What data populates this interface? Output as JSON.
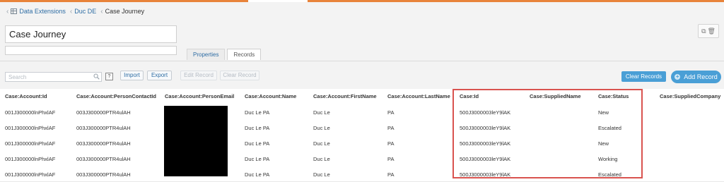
{
  "breadcrumb": {
    "item1": "Data Extensions",
    "item2": "Duc DE",
    "current": "Case Journey"
  },
  "title_field": {
    "value": "Case Journey"
  },
  "description_field": {
    "value": ""
  },
  "tabs": [
    {
      "label": "Properties"
    },
    {
      "label": "Records"
    }
  ],
  "toolbar": {
    "search_placeholder": "Search",
    "help_label": "?",
    "import_label": "Import",
    "export_label": "Export",
    "edit_record_label": "Edit Record",
    "clear_record_label": "Clear Record",
    "clear_records_label": "Clear Records",
    "add_record_label": "Add Record"
  },
  "table": {
    "columns": [
      "Case:Account:Id",
      "Case:Account:PersonContactId",
      "Case:Account:PersonEmail",
      "Case:Account:Name",
      "Case:Account:FirstName",
      "Case:Account:LastName",
      "Case:Id",
      "Case:SuppliedName",
      "Case:Status",
      "Case:SuppliedCompany"
    ],
    "rows": [
      [
        "001J300000lnPhxlAF",
        "003J300000PTR4ulAH",
        "",
        "Duc Le PA",
        "Duc Le",
        "PA",
        "500J3000003leY9lAK",
        "",
        "New",
        ""
      ],
      [
        "001J300000lnPhxlAF",
        "003J300000PTR4ulAH",
        "",
        "Duc Le PA",
        "Duc Le",
        "PA",
        "500J3000003leY9lAK",
        "",
        "Escalated",
        ""
      ],
      [
        "001J300000lnPhxlAF",
        "003J300000PTR4ulAH",
        "",
        "Duc Le PA",
        "Duc Le",
        "PA",
        "500J3000003leY9lAK",
        "",
        "New",
        ""
      ],
      [
        "001J300000lnPhxlAF",
        "003J300000PTR4ulAH",
        "",
        "Duc Le PA",
        "Duc Le",
        "PA",
        "500J3000003leY9lAK",
        "",
        "Working",
        ""
      ],
      [
        "001J300000lnPhxlAF",
        "003J300000PTR4ulAH",
        "",
        "Duc Le PA",
        "Duc Le",
        "PA",
        "500J3000003leY9lAK",
        "",
        "Escalated",
        ""
      ]
    ]
  },
  "colors": {
    "accent": "#e8833a",
    "primary_button": "#4a9fd6",
    "link": "#2e6da4",
    "highlight_border": "#d9534f"
  }
}
